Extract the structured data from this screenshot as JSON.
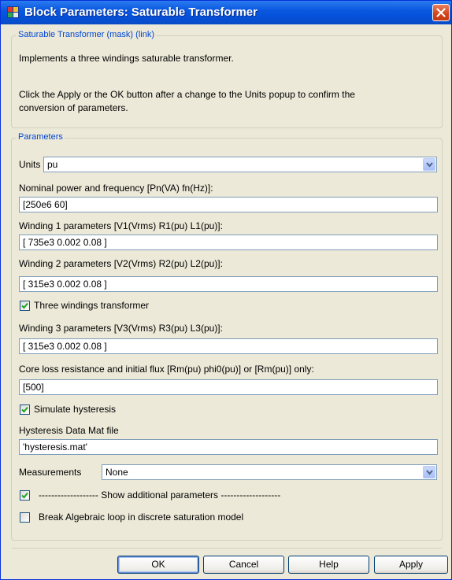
{
  "window": {
    "title": "Block Parameters: Saturable Transformer"
  },
  "mask_group": {
    "legend": "Saturable Transformer (mask) (link)",
    "description_1": "Implements a three windings saturable transformer.",
    "description_2a": "Click the Apply or the OK button after a change to the Units popup to confirm the",
    "description_2b": "conversion of parameters."
  },
  "params_group": {
    "legend": "Parameters",
    "units": {
      "label": "Units",
      "value": "pu"
    },
    "nominal": {
      "label": "Nominal power and frequency [Pn(VA) fn(Hz)]:",
      "value": "[250e6 60]"
    },
    "winding1": {
      "label": "Winding 1 parameters [V1(Vrms) R1(pu) L1(pu)]:",
      "value": "[ 735e3  0.002  0.08 ]"
    },
    "winding2": {
      "label": "Winding 2 parameters [V2(Vrms) R2(pu) L2(pu)]:",
      "value": "[ 315e3  0.002  0.08 ]"
    },
    "three_windings": {
      "label": "Three windings transformer",
      "checked": true
    },
    "winding3": {
      "label": "Winding 3 parameters [V3(Vrms) R3(pu) L3(pu)]:",
      "value": "[ 315e3  0.002  0.08 ]"
    },
    "core_loss": {
      "label": "Core loss resistance and initial flux [Rm(pu) phi0(pu)] or [Rm(pu)] only:",
      "value": "[500]"
    },
    "simulate_hysteresis": {
      "label": "Simulate hysteresis",
      "checked": true
    },
    "hysteresis_file": {
      "label": "Hysteresis Data Mat file",
      "value": "'hysteresis.mat'"
    },
    "measurements": {
      "label": "Measurements",
      "value": "None"
    },
    "show_additional": {
      "label": "------------------- Show additional parameters -------------------",
      "checked": true
    },
    "break_loop": {
      "label": "Break Algebraic loop in discrete saturation model",
      "checked": false
    }
  },
  "buttons": {
    "ok": "OK",
    "cancel": "Cancel",
    "help": "Help",
    "apply": "Apply"
  },
  "colors": {
    "title_bar": "#0a58e0",
    "legend": "#0046d5",
    "dialog_bg": "#ece9d8",
    "close": "#d5421a"
  }
}
